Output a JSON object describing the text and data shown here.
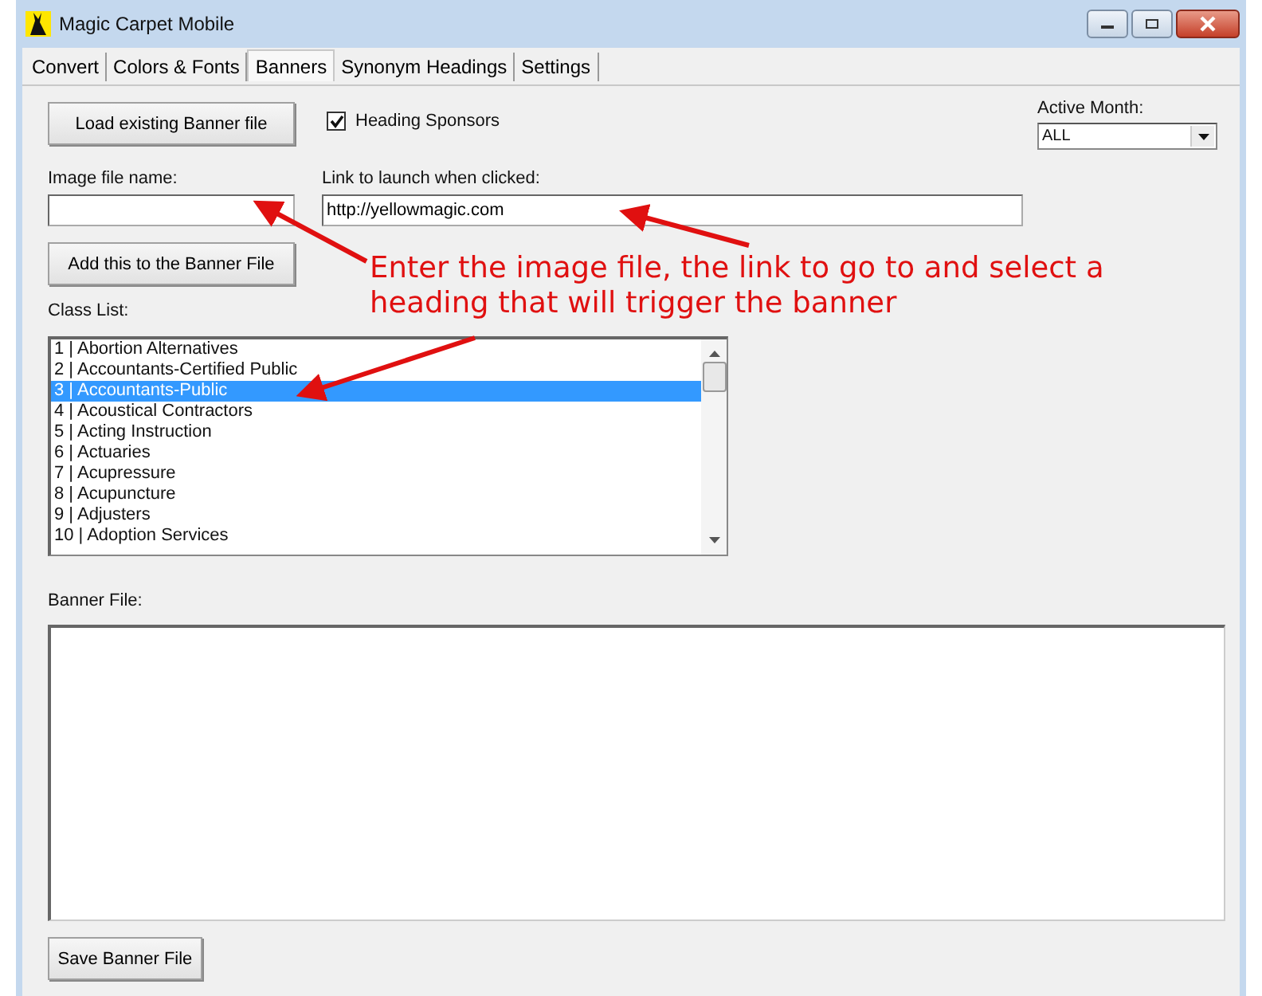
{
  "window": {
    "title": "Magic Carpet Mobile"
  },
  "tabs": [
    {
      "label": "Convert",
      "selected": false
    },
    {
      "label": "Colors & Fonts",
      "selected": false
    },
    {
      "label": "Banners",
      "selected": true
    },
    {
      "label": "Synonym Headings",
      "selected": false
    },
    {
      "label": "Settings",
      "selected": false
    }
  ],
  "load_button": "Load existing Banner file",
  "heading_sponsors": {
    "label": "Heading Sponsors",
    "checked": true
  },
  "active_month": {
    "label": "Active Month:",
    "value": "ALL"
  },
  "image_file": {
    "label": "Image file name:"
  },
  "link": {
    "label": "Link to launch when clicked:",
    "value": "http://yellowmagic.com"
  },
  "add_button": "Add this to the Banner File",
  "class_list": {
    "label": "Class List:",
    "items": [
      {
        "text": "1 | Abortion Alternatives",
        "selected": false
      },
      {
        "text": "2 | Accountants-Certified Public",
        "selected": false
      },
      {
        "text": "3 | Accountants-Public",
        "selected": true
      },
      {
        "text": "4 | Acoustical Contractors",
        "selected": false
      },
      {
        "text": "5 | Acting Instruction",
        "selected": false
      },
      {
        "text": "6 | Actuaries",
        "selected": false
      },
      {
        "text": "7 | Acupressure",
        "selected": false
      },
      {
        "text": "8 | Acupuncture",
        "selected": false
      },
      {
        "text": "9 | Adjusters",
        "selected": false
      },
      {
        "text": "10 | Adoption Services",
        "selected": false
      }
    ]
  },
  "banner_file": {
    "label": "Banner File:"
  },
  "save_button": "Save Banner File",
  "annotation": {
    "text": "Enter the image file, the link to go to and select a heading that will trigger the banner"
  }
}
